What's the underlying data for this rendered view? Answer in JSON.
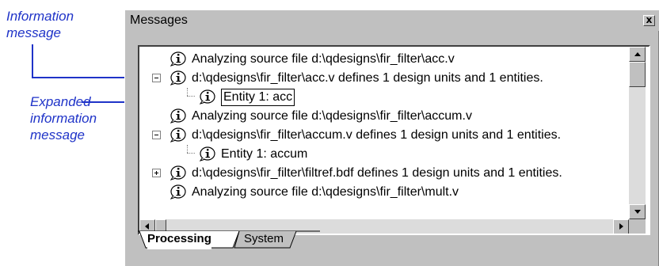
{
  "annotations": {
    "info_message": [
      "Information",
      "message"
    ],
    "expanded_message": [
      "Expanded",
      "information",
      "message"
    ]
  },
  "window": {
    "title": "Messages",
    "close_label": "x"
  },
  "messages": [
    {
      "text": "Analyzing source file d:\\qdesigns\\fir_filter\\acc.v",
      "expander": "none",
      "level": 0
    },
    {
      "text": "d:\\qdesigns\\fir_filter\\acc.v defines 1 design units and 1 entities.",
      "expander": "collapse",
      "level": 0
    },
    {
      "text": "Entity 1: acc",
      "expander": "none",
      "level": 1,
      "selected": true
    },
    {
      "text": "Analyzing source file d:\\qdesigns\\fir_filter\\accum.v",
      "expander": "none",
      "level": 0
    },
    {
      "text": "d:\\qdesigns\\fir_filter\\accum.v defines 1 design units and 1 entities.",
      "expander": "collapse",
      "level": 0
    },
    {
      "text": "Entity 1: accum",
      "expander": "none",
      "level": 1
    },
    {
      "text": "d:\\qdesigns\\fir_filter\\filtref.bdf defines 1 design units and 1 entities.",
      "expander": "expand",
      "level": 0
    },
    {
      "text": "Analyzing source file d:\\qdesigns\\fir_filter\\mult.v",
      "expander": "none",
      "level": 0
    }
  ],
  "tabs": [
    {
      "label": "Processing",
      "active": true
    },
    {
      "label": "System",
      "active": false
    }
  ],
  "colors": {
    "annotation": "#1f33c8",
    "window_bg": "#c0c0c0",
    "list_bg": "#ffffff"
  },
  "icons": {
    "message": "info-icon",
    "close": "close-icon",
    "scroll_up": "arrow-up-icon",
    "scroll_down": "arrow-down-icon",
    "scroll_left": "arrow-left-icon",
    "scroll_right": "arrow-right-icon"
  }
}
